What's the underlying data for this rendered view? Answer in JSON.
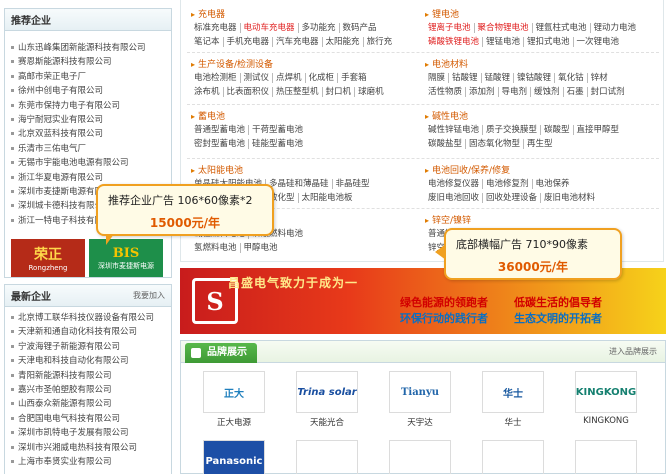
{
  "left": {
    "recommended": {
      "title": "推荐企业",
      "items": [
        "山东迅峰集团新能源科技有限公司",
        "赛恩斯能源科技有限公司",
        "高邮市荣正电子厂",
        "徐州中创电子有限公司",
        "东莞市保持力电子有限公司",
        "海宁耐冠实业有限公司",
        "北京双蓝科技有限公司",
        "乐清市三佑电气厂",
        "无锡市宇能电池电源有限公司",
        "浙江华夏电源有限公司",
        "深圳市麦捷斯电源有限公司",
        "深圳城卡德科技有限公司",
        "浙江一特电子科技有限公司"
      ],
      "logos": [
        {
          "big": "荣正",
          "small": "Rongzheng"
        },
        {
          "big": "BIS",
          "small": "深圳市麦捷斯电源"
        }
      ]
    },
    "newest": {
      "title": "最新企业",
      "more": "我要加入",
      "items": [
        "北京博工联华科技仪器设备有限公司",
        "天津新和通自动化科技有限公司",
        "宁波海锂子新能源有限公司",
        "天津电和科技自动化有限公司",
        "青阳新能源科技有限公司",
        "嘉兴市圣帕塑胶有限公司",
        "山西泰众新能源有限公司",
        "合肥国电电气科技有限公司",
        "深圳市凯特电子发展有限公司",
        "深圳市兴湘威电热科技有限公司",
        "上海市奉贤实业有限公司"
      ]
    }
  },
  "categories": {
    "left": [
      {
        "title": "充电器",
        "lines": [
          [
            "标准充电器",
            "电动车充电器",
            "多功能充",
            "数码产品"
          ],
          [
            "笔记本",
            "手机充电器",
            "汽车充电器",
            "太阳能充",
            "旅行充"
          ]
        ]
      },
      {
        "title": "生产设备/检测设备",
        "lines": [
          [
            "电池检测柜",
            "测试仪",
            "点焊机",
            "化成柜",
            "手套箱"
          ],
          [
            "涂布机",
            "比表面积仪",
            "热压整型机",
            "封口机",
            "球磨机"
          ]
        ]
      },
      {
        "title": "蓄电池",
        "lines": [
          [
            "普通型蓄电池",
            "干荷型蓄电池"
          ],
          [
            "密封型蓄电池",
            "硅能型蓄电池"
          ]
        ]
      },
      {
        "title": "太阳能电池",
        "lines": [
          [
            "单晶硅太阳能电池",
            "多晶硅和薄晶硅",
            "非晶硅型"
          ],
          [
            "光电化学电池",
            "染料敏化型",
            "太阳能电池板"
          ]
        ]
      },
      {
        "title": "燃料电池",
        "lines": [
          [
            "碱性燃料电池",
            "磷酸燃料电池"
          ],
          [
            "氢燃料电池",
            "甲醇电池"
          ]
        ]
      }
    ],
    "right": [
      {
        "title": "锂电池",
        "lines": [
          [
            "锂离子电池",
            "聚合物锂电池",
            "锂氩柱式电池",
            "锂动力电池"
          ],
          [
            "磷酸铁锂电池",
            "锂锰电池",
            "锂扣式电池",
            "一次锂电池"
          ]
        ]
      },
      {
        "title": "电池材料",
        "lines": [
          [
            "隔膜",
            "钴酸锂",
            "锰酸锂",
            "镍钴酸锂",
            "氧化钴",
            "锌材"
          ],
          [
            "活性物质",
            "添加剂",
            "导电剂",
            "缓蚀剂",
            "石墨",
            "封口试剂"
          ]
        ]
      },
      {
        "title": "碱性电池",
        "lines": [
          [
            "碱性锌锰电池",
            "质子交换膜型",
            "碳酸型",
            "直接甲醇型"
          ],
          [
            "碳酸盐型",
            "固态氧化物型",
            "再生型"
          ]
        ]
      },
      {
        "title": "电池回收/保养/修复",
        "lines": [
          [
            "电池修复仪器",
            "电池修复剂",
            "电池保养"
          ],
          [
            "废旧电池回收",
            "回收处理设备",
            "废旧电池材料"
          ]
        ]
      },
      {
        "title": "锌空/镍锌",
        "lines": [
          [
            "普通锌空电池",
            "镍锌电池"
          ],
          [
            "锌空气电池"
          ]
        ]
      }
    ]
  },
  "banner": {
    "logo": "S",
    "slogan": "昌盛电气致力于成为一",
    "line1": "绿色能源的领跑者",
    "line2": "环保行动的践行者",
    "line3": "低碳生活的倡导者",
    "line4": "生态文明的开拓者"
  },
  "brand": {
    "title": "品牌展示",
    "more": "进入品牌展示",
    "items": [
      {
        "logo": "正大",
        "name": "正大电源"
      },
      {
        "logo": "Trina solar",
        "name": "天能光合"
      },
      {
        "logo": "Tianyu",
        "name": "天宇达"
      },
      {
        "logo": "华士",
        "name": "华士"
      },
      {
        "logo": "KINGKONG",
        "name": "KINGKONG"
      },
      {
        "logo": "Panasonic",
        "name": ""
      },
      {
        "logo": "",
        "name": ""
      },
      {
        "logo": "",
        "name": ""
      },
      {
        "logo": "",
        "name": ""
      },
      {
        "logo": "",
        "name": ""
      }
    ]
  },
  "ads": {
    "side": {
      "text": "推荐企业广告  106*60像素*2",
      "price": "15000元/年"
    },
    "banner": {
      "text": "底部横幅广告  710*90像素",
      "price": "36000元/年"
    }
  }
}
